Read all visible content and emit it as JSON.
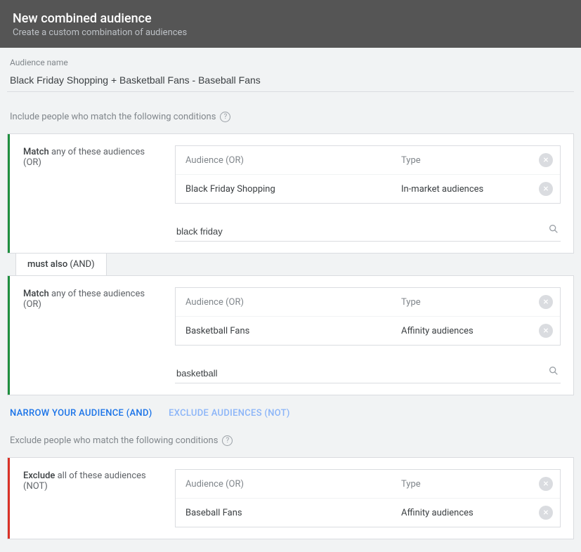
{
  "header": {
    "title": "New combined audience",
    "subtitle": "Create a custom combination of audiences"
  },
  "name_field": {
    "label": "Audience name",
    "value": "Black Friday Shopping + Basketball Fans - Baseball Fans"
  },
  "include_header": "Include people who match the following conditions",
  "exclude_header": "Exclude people who match the following conditions",
  "table_hdr_audience": "Audience (OR)",
  "table_hdr_type": "Type",
  "include_groups": [
    {
      "label_prefix": "Match",
      "label_rest": " any of these audiences (OR)",
      "rows": [
        {
          "name": "Black Friday Shopping",
          "type": "In-market audiences"
        }
      ],
      "search_value": "black friday"
    },
    {
      "label_prefix": "Match",
      "label_rest": " any of these audiences (OR)",
      "rows": [
        {
          "name": "Basketball Fans",
          "type": "Affinity audiences"
        }
      ],
      "search_value": "basketball"
    }
  ],
  "connector": {
    "bold": "must also",
    "rest": " (AND)"
  },
  "actions": {
    "narrow": "NARROW YOUR AUDIENCE (AND)",
    "exclude_link": "EXCLUDE AUDIENCES (NOT)"
  },
  "exclude_group": {
    "label_prefix": "Exclude",
    "label_rest": " all of these audiences (NOT)",
    "rows": [
      {
        "name": "Baseball Fans",
        "type": "Affinity audiences"
      }
    ]
  }
}
